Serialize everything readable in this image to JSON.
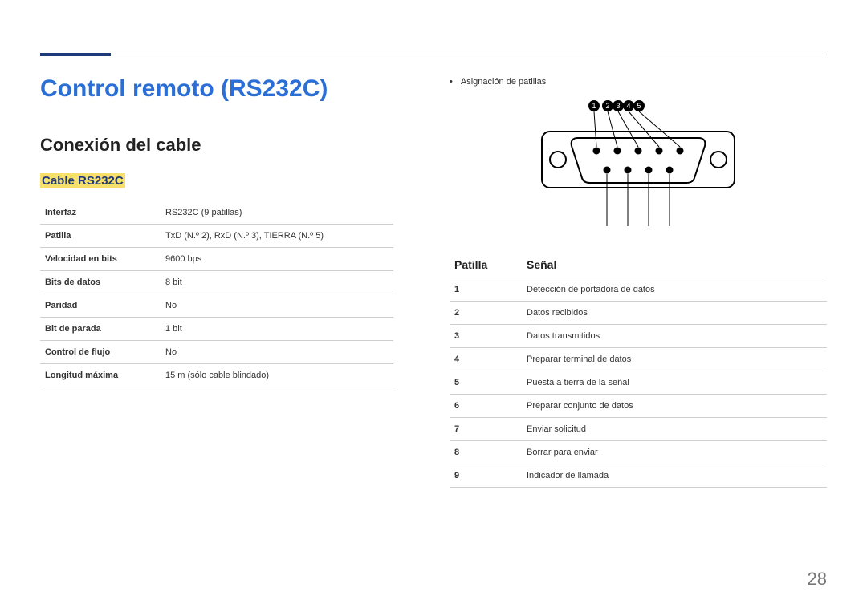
{
  "page_title": "Control remoto (RS232C)",
  "left": {
    "section_title": "Conexión del cable",
    "subsection_title": "Cable RS232C",
    "spec": [
      {
        "label": "Interfaz",
        "value": "RS232C (9 patillas)"
      },
      {
        "label": "Patilla",
        "value": "TxD (N.º 2), RxD (N.º 3), TIERRA (N.º 5)"
      },
      {
        "label": "Velocidad en bits",
        "value": "9600 bps"
      },
      {
        "label": "Bits de datos",
        "value": "8 bit"
      },
      {
        "label": "Paridad",
        "value": "No"
      },
      {
        "label": "Bit de parada",
        "value": "1 bit"
      },
      {
        "label": "Control de flujo",
        "value": "No"
      },
      {
        "label": "Longitud máxima",
        "value": "15 m (sólo cable blindado)"
      }
    ]
  },
  "right": {
    "bullet": "Asignación de patillas",
    "diagram_labels": [
      "1",
      "2",
      "3",
      "4",
      "5"
    ],
    "pin_header": {
      "pin": "Patilla",
      "signal": "Señal"
    },
    "pins": [
      {
        "n": "1",
        "s": "Detección de portadora de datos"
      },
      {
        "n": "2",
        "s": "Datos recibidos"
      },
      {
        "n": "3",
        "s": "Datos transmitidos"
      },
      {
        "n": "4",
        "s": "Preparar terminal de datos"
      },
      {
        "n": "5",
        "s": "Puesta a tierra de la señal"
      },
      {
        "n": "6",
        "s": "Preparar conjunto de datos"
      },
      {
        "n": "7",
        "s": "Enviar solicitud"
      },
      {
        "n": "8",
        "s": "Borrar para enviar"
      },
      {
        "n": "9",
        "s": "Indicador de llamada"
      }
    ]
  },
  "page_number": "28"
}
